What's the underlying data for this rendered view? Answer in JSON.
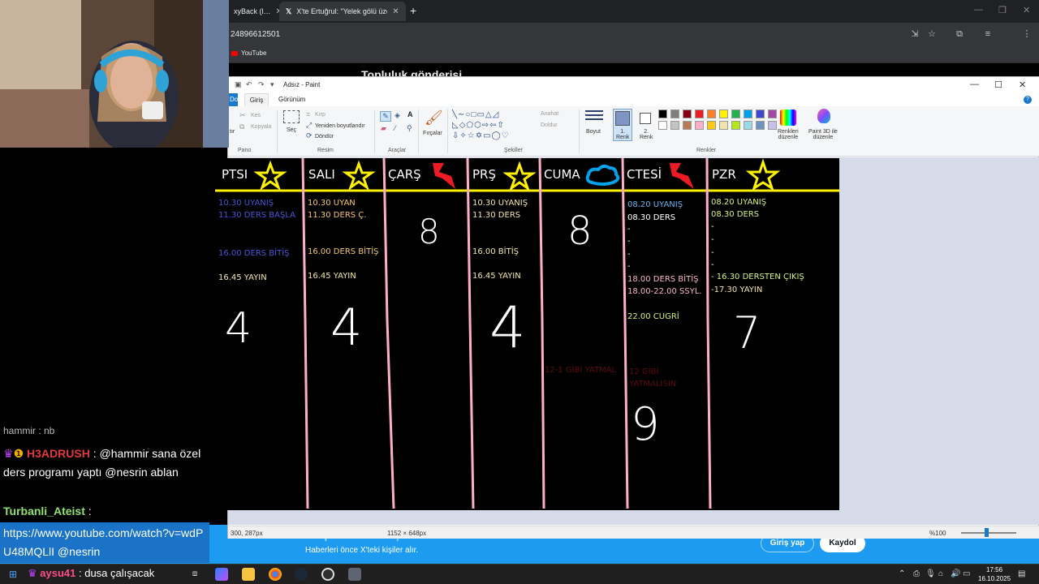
{
  "browser": {
    "tabs": [
      {
        "label": "xyBack (l…"
      },
      {
        "label": "X'te Ertuğrul: \"Yelek gölü üzerin…"
      }
    ],
    "url": "24896612501",
    "bookmark": "YouTube",
    "page_heading": "Topluluk gönderisi"
  },
  "banner": {
    "title": "Olup bitenleri kaçırma",
    "subtitle": "Haberleri önce X'teki kişiler alır.",
    "login": "Giriş yap",
    "signup": "Kaydol"
  },
  "paint": {
    "title": "Adsız - Paint",
    "tabs": {
      "file": "Dosya",
      "home": "Giriş",
      "view": "Görünüm"
    },
    "groups": {
      "clipboard": "Pano",
      "image": "Resim",
      "tools": "Araçlar",
      "shapes": "Şekiller",
      "colors": "Renkler"
    },
    "clipboard": {
      "paste": "tır",
      "cut": "Kes",
      "copy": "Kopyala"
    },
    "image": {
      "select": "Seç",
      "crop": "Kırp",
      "resize": "Yeniden boyutlandır",
      "rotate": "Döndür"
    },
    "brushes": "Fırçalar",
    "shapes": {
      "outline": "Anahat",
      "fill": "Doldur"
    },
    "size": "Boyut",
    "color1": "1.\nRenk",
    "color2": "2.\nRenk",
    "edit_colors": "Renkleri\ndüzenle",
    "paint3d": "Paint 3D ile\ndüzenle",
    "palette": [
      "#000000",
      "#7f7f7f",
      "#880015",
      "#ed1c24",
      "#ff7f27",
      "#fff200",
      "#22b14c",
      "#00a2e8",
      "#3f48cc",
      "#a349a4",
      "#ffffff",
      "#c3c3c3",
      "#b97a57",
      "#ffaec9",
      "#ffc90e",
      "#efe4b0",
      "#b5e61d",
      "#99d9ea",
      "#7092be",
      "#c8bfe7"
    ],
    "status": {
      "position": "300, 287px",
      "size": "1152 × 648px",
      "zoom": "%100"
    }
  },
  "schedule": {
    "days": [
      {
        "name": "PTSI",
        "total": "4",
        "entries": [
          {
            "text": "10.30 UYANIŞ",
            "color": "#4b55d6"
          },
          {
            "text": "11.30 DERS BAŞLA",
            "color": "#4b55d6"
          },
          {
            "text": "16.00 DERS BİTİŞ",
            "color": "#4b55d6"
          },
          {
            "text": "16.45 YAYIN",
            "color": "#f3e7a8"
          }
        ]
      },
      {
        "name": "SALI",
        "total": "4",
        "entries": [
          {
            "text": "10.30 UYAN",
            "color": "#f5c96a"
          },
          {
            "text": "11.30 DERS Ç.",
            "color": "#f5c96a"
          },
          {
            "text": "16.00 DERS BİTİŞ",
            "color": "#f5c96a"
          },
          {
            "text": "16.45 YAYIN",
            "color": "#f3e7a8"
          }
        ]
      },
      {
        "name": "ÇARŞ",
        "total": "8",
        "entries": []
      },
      {
        "name": "PRŞ",
        "total": "4",
        "entries": [
          {
            "text": "10.30 UYANIŞ",
            "color": "#f3e7a8"
          },
          {
            "text": "11.30 DERS",
            "color": "#f3e7a8"
          },
          {
            "text": "16.00 BİTİŞ",
            "color": "#f3e7a8"
          },
          {
            "text": "16.45 YAYIN",
            "color": "#f3e7a8"
          }
        ]
      },
      {
        "name": "CUMA",
        "total": "8",
        "entries": []
      },
      {
        "name": "CTESİ",
        "total": "9",
        "entries": [
          {
            "text": "08.20 UYANIŞ",
            "color": "#66b4f0"
          },
          {
            "text": "08.30 DERS",
            "color": "#ffffff"
          },
          {
            "text": "18.00 DERS BİTİŞ",
            "color": "#f7b5cf"
          },
          {
            "text": "18.00-22.00 SSYL.",
            "color": "#f7b5cf"
          },
          {
            "text": "22.00 CUGRİ",
            "color": "#d6f27a"
          }
        ]
      },
      {
        "name": "PZR",
        "total": "7",
        "entries": [
          {
            "text": "08.20 UYANIŞ",
            "color": "#d6f27a"
          },
          {
            "text": "08.30 DERS",
            "color": "#d6f27a"
          },
          {
            "text": "- 16.30 DERSTEN ÇIKIŞ",
            "color": "#d6f27a"
          },
          {
            "text": "-17.30 YAYIN",
            "color": "#f3e7a8"
          }
        ]
      }
    ],
    "dash": "-",
    "notes": [
      "12-1 GİBİ YATMAL",
      "12 GİBİ\nYATMALISIN"
    ]
  },
  "chat": {
    "partial": "hammir : nb",
    "msg1_user": "H3ADRUSH",
    "msg1_text": " : @hammir sana özel ders programı yaptı @nesrin ablan",
    "msg2_user": "Turbanli_Ateist",
    "msg2_sep": " :",
    "msg2_text": "https://www.youtube.com/watch?v=wdPU48MQLlI @nesrin",
    "msg3_user": "aysu41",
    "msg3_text": " : dusa çalışacak"
  },
  "taskbar": {
    "time": "17:56",
    "date": "16.10.2025"
  }
}
